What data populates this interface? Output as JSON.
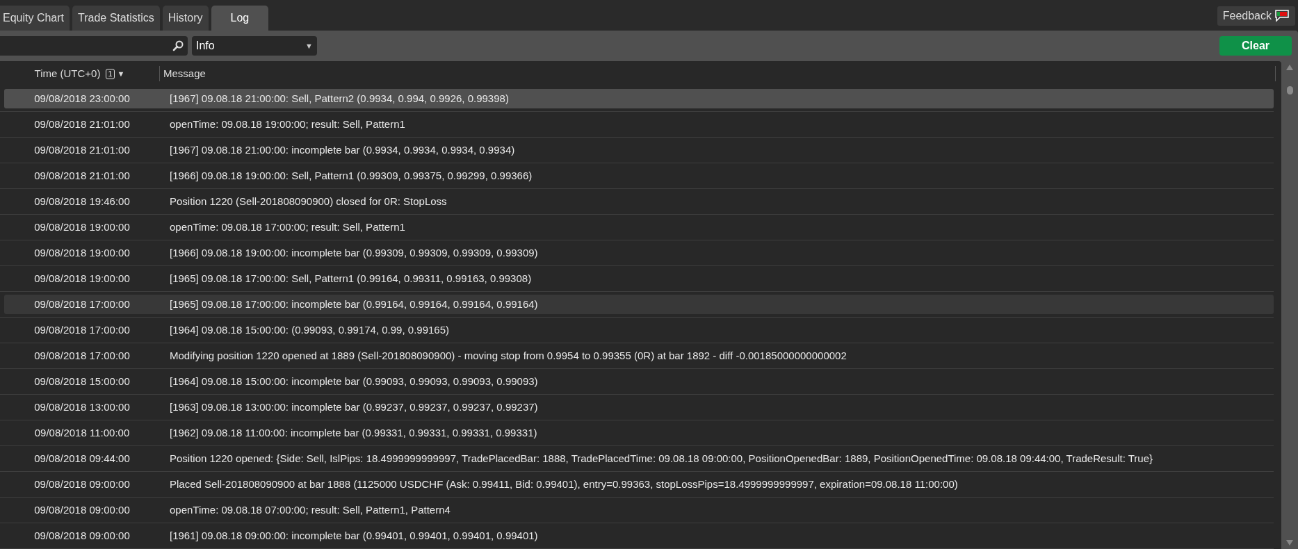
{
  "tabs": [
    {
      "label": "Equity Chart",
      "selected": false
    },
    {
      "label": "Trade Statistics",
      "selected": false
    },
    {
      "label": "History",
      "selected": false
    },
    {
      "label": "Log",
      "selected": true
    }
  ],
  "feedback": {
    "label": "Feedback"
  },
  "toolbar": {
    "level_select": {
      "value": "Info",
      "caret": "▼"
    },
    "clear_button": "Clear"
  },
  "table": {
    "columns": [
      {
        "label": "Time (UTC+0)",
        "sort_index": "1",
        "sort_caret": "▼"
      },
      {
        "label": "Message"
      }
    ],
    "rows": [
      {
        "time": "09/08/2018 23:00:00",
        "message": "[1967] 09.08.18 21:00:00: Sell, Pattern2 (0.9934, 0.994, 0.9926, 0.99398)",
        "selected": true,
        "hovered": false
      },
      {
        "time": "09/08/2018 21:01:00",
        "message": "openTime: 09.08.18 19:00:00; result: Sell, Pattern1",
        "selected": false,
        "hovered": false
      },
      {
        "time": "09/08/2018 21:01:00",
        "message": "[1967] 09.08.18 21:00:00: incomplete bar (0.9934, 0.9934, 0.9934, 0.9934)",
        "selected": false,
        "hovered": false
      },
      {
        "time": "09/08/2018 21:01:00",
        "message": "[1966] 09.08.18 19:00:00: Sell, Pattern1 (0.99309, 0.99375, 0.99299, 0.99366)",
        "selected": false,
        "hovered": false
      },
      {
        "time": "09/08/2018 19:46:00",
        "message": "Position 1220 (Sell-201808090900) closed for 0R: StopLoss",
        "selected": false,
        "hovered": false
      },
      {
        "time": "09/08/2018 19:00:00",
        "message": "openTime: 09.08.18 17:00:00; result: Sell, Pattern1",
        "selected": false,
        "hovered": false
      },
      {
        "time": "09/08/2018 19:00:00",
        "message": "[1966] 09.08.18 19:00:00: incomplete bar (0.99309, 0.99309, 0.99309, 0.99309)",
        "selected": false,
        "hovered": false
      },
      {
        "time": "09/08/2018 19:00:00",
        "message": "[1965] 09.08.18 17:00:00: Sell, Pattern1 (0.99164, 0.99311, 0.99163, 0.99308)",
        "selected": false,
        "hovered": false
      },
      {
        "time": "09/08/2018 17:00:00",
        "message": "[1965] 09.08.18 17:00:00: incomplete bar (0.99164, 0.99164, 0.99164, 0.99164)",
        "selected": false,
        "hovered": true
      },
      {
        "time": "09/08/2018 17:00:00",
        "message": "[1964] 09.08.18 15:00:00: (0.99093, 0.99174, 0.99, 0.99165)",
        "selected": false,
        "hovered": false
      },
      {
        "time": "09/08/2018 17:00:00",
        "message": "Modifying position 1220 opened at 1889 (Sell-201808090900) - moving stop from 0.9954 to 0.99355 (0R) at bar 1892 - diff -0.00185000000000002",
        "selected": false,
        "hovered": false
      },
      {
        "time": "09/08/2018 15:00:00",
        "message": "[1964] 09.08.18 15:00:00: incomplete bar (0.99093, 0.99093, 0.99093, 0.99093)",
        "selected": false,
        "hovered": false
      },
      {
        "time": "09/08/2018 13:00:00",
        "message": "[1963] 09.08.18 13:00:00: incomplete bar (0.99237, 0.99237, 0.99237, 0.99237)",
        "selected": false,
        "hovered": false
      },
      {
        "time": "09/08/2018 11:00:00",
        "message": "[1962] 09.08.18 11:00:00: incomplete bar (0.99331, 0.99331, 0.99331, 0.99331)",
        "selected": false,
        "hovered": false
      },
      {
        "time": "09/08/2018 09:44:00",
        "message": "Position 1220 opened: {Side: Sell, IslPips: 18.4999999999997, TradePlacedBar: 1888, TradePlacedTime: 09.08.18 09:00:00, PositionOpenedBar: 1889, PositionOpenedTime: 09.08.18 09:44:00, TradeResult: True}",
        "selected": false,
        "hovered": false
      },
      {
        "time": "09/08/2018 09:00:00",
        "message": "Placed Sell-201808090900 at bar 1888 (1125000 USDCHF (Ask: 0.99411, Bid: 0.99401), entry=0.99363, stopLossPips=18.4999999999997, expiration=09.08.18 11:00:00)",
        "selected": false,
        "hovered": false
      },
      {
        "time": "09/08/2018 09:00:00",
        "message": "openTime: 09.08.18 07:00:00; result: Sell, Pattern1, Pattern4",
        "selected": false,
        "hovered": false
      },
      {
        "time": "09/08/2018 09:00:00",
        "message": "[1961] 09.08.18 09:00:00: incomplete bar (0.99401, 0.99401, 0.99401, 0.99401)",
        "selected": false,
        "hovered": false
      }
    ]
  }
}
